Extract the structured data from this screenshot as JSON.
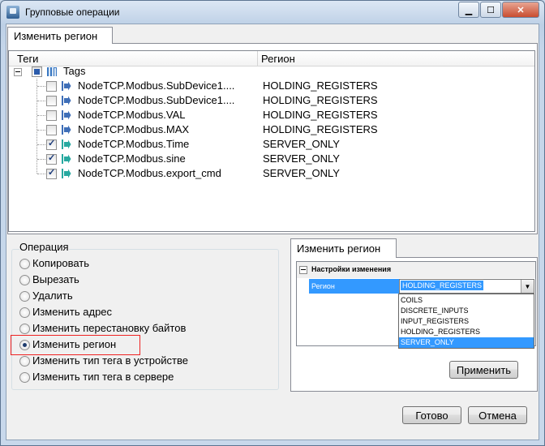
{
  "window": {
    "title": "Групповые операции"
  },
  "top_tab": {
    "label": "Изменить регион"
  },
  "tree": {
    "col_tags": "Теги",
    "col_region": "Регион",
    "root_label": "Tags",
    "rows": [
      {
        "name": "NodeTCP.Modbus.SubDevice1....",
        "region": "HOLDING_REGISTERS",
        "checked": false
      },
      {
        "name": "NodeTCP.Modbus.SubDevice1....",
        "region": "HOLDING_REGISTERS",
        "checked": false
      },
      {
        "name": "NodeTCP.Modbus.VAL",
        "region": "HOLDING_REGISTERS",
        "checked": false
      },
      {
        "name": "NodeTCP.Modbus.MAX",
        "region": "HOLDING_REGISTERS",
        "checked": false
      },
      {
        "name": "NodeTCP.Modbus.Time",
        "region": "SERVER_ONLY",
        "checked": true
      },
      {
        "name": "NodeTCP.Modbus.sine",
        "region": "SERVER_ONLY",
        "checked": true
      },
      {
        "name": "NodeTCP.Modbus.export_cmd",
        "region": "SERVER_ONLY",
        "checked": true
      }
    ]
  },
  "operations": {
    "title": "Операция",
    "items": [
      {
        "label": "Копировать",
        "selected": false
      },
      {
        "label": "Вырезать",
        "selected": false
      },
      {
        "label": "Удалить",
        "selected": false
      },
      {
        "label": "Изменить адрес",
        "selected": false
      },
      {
        "label": "Изменить перестановку байтов",
        "selected": false
      },
      {
        "label": "Изменить регион",
        "selected": true
      },
      {
        "label": "Изменить тип тега в устройстве",
        "selected": false
      },
      {
        "label": "Изменить тип тега в сервере",
        "selected": false
      }
    ]
  },
  "settings_panel": {
    "tab_label": "Изменить регион",
    "category": "Настройки изменения",
    "property_name": "Регион",
    "property_value": "HOLDING_REGISTERS",
    "options": [
      "COILS",
      "DISCRETE_INPUTS",
      "INPUT_REGISTERS",
      "HOLDING_REGISTERS",
      "SERVER_ONLY"
    ],
    "highlighted_option": "SERVER_ONLY",
    "apply_label": "Применить"
  },
  "footer": {
    "ok_label": "Готово",
    "cancel_label": "Отмена"
  }
}
